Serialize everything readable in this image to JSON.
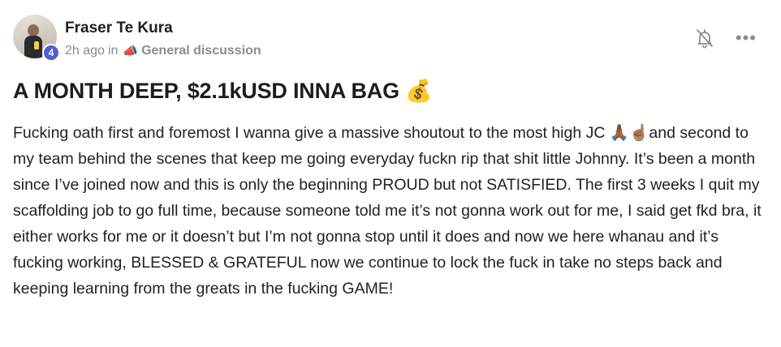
{
  "post": {
    "author": "Fraser Te Kura",
    "level": "4",
    "time": "2h ago",
    "in_word": "in",
    "category_icon": "📣",
    "category": "General discussion",
    "title": "A MONTH DEEP, $2.1kUSD INNA BAG 💰",
    "body": "Fucking oath first and foremost I wanna give a massive shoutout to the most high JC 🙏🏾☝🏽and second to my team behind the scenes that keep me going everyday fuckn rip that shit little Johnny. It’s been a month since I’ve joined now and this is only the beginning PROUD but not SATISFIED. The first 3 weeks I quit my scaffolding job to go full time, because someone told me it’s not gonna work out for me, I said get fkd bra, it either works for me or it doesn’t but I’m not gonna stop until it does and now we here whanau and it’s fucking working, BLESSED & GRATEFUL now we continue to lock the fuck in take no steps back and keeping learning from the greats in the fucking GAME!"
  },
  "icons": {
    "bell": "bell-off-icon",
    "more": "more-horizontal-icon"
  },
  "colors": {
    "badge": "#4f5fd6",
    "muted": "#8c8c8c",
    "text": "#222222"
  }
}
